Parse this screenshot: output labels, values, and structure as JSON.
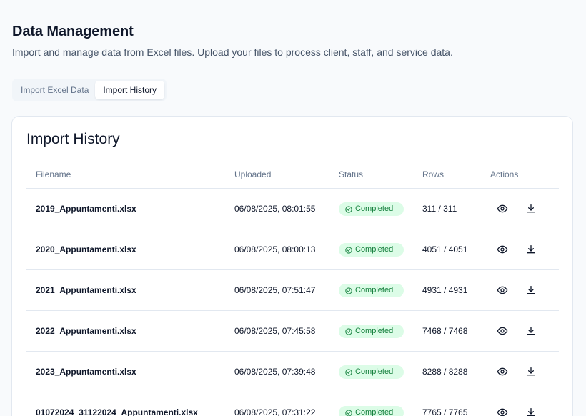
{
  "header": {
    "title": "Data Management",
    "subtitle": "Import and manage data from Excel files. Upload your files to process client, staff, and service data."
  },
  "tabs": [
    {
      "label": "Import Excel Data",
      "active": false
    },
    {
      "label": "Import History",
      "active": true
    }
  ],
  "card": {
    "title": "Import History",
    "columns": [
      "Filename",
      "Uploaded",
      "Status",
      "Rows",
      "Actions"
    ],
    "rows": [
      {
        "filename": "2019_Appuntamenti.xlsx",
        "uploaded": "06/08/2025, 08:01:55",
        "status": "Completed",
        "rows": "311 / 311"
      },
      {
        "filename": "2020_Appuntamenti.xlsx",
        "uploaded": "06/08/2025, 08:00:13",
        "status": "Completed",
        "rows": "4051 / 4051"
      },
      {
        "filename": "2021_Appuntamenti.xlsx",
        "uploaded": "06/08/2025, 07:51:47",
        "status": "Completed",
        "rows": "4931 / 4931"
      },
      {
        "filename": "2022_Appuntamenti.xlsx",
        "uploaded": "06/08/2025, 07:45:58",
        "status": "Completed",
        "rows": "7468 / 7468"
      },
      {
        "filename": "2023_Appuntamenti.xlsx",
        "uploaded": "06/08/2025, 07:39:48",
        "status": "Completed",
        "rows": "8288 / 8288"
      },
      {
        "filename": "01072024_31122024_Appuntamenti.xlsx",
        "uploaded": "06/08/2025, 07:31:22",
        "status": "Completed",
        "rows": "7765 / 7765"
      }
    ],
    "row_actions": [
      "eye-icon",
      "download-icon"
    ]
  },
  "colors": {
    "status_bg": "#dcfce7",
    "status_text": "#15803d",
    "background": "#f8fafc"
  }
}
